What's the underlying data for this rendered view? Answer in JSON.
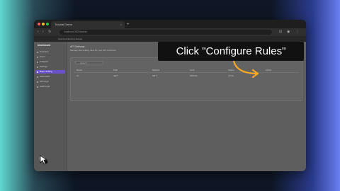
{
  "browser": {
    "tab_title": "Tutorial Demo",
    "tab_close": "×",
    "new_tab": "+",
    "url": "localhost:3000/admin",
    "nav": {
      "back": "‹",
      "forward": "›",
      "reload": "↻"
    },
    "bookmarks": [
      "Dashboard",
      "Getting Started"
    ]
  },
  "sidebar": {
    "brand": "Dashboard",
    "items": [
      {
        "label": "Overview"
      },
      {
        "label": "Users"
      },
      {
        "label": "Analytics"
      },
      {
        "label": "Settings"
      },
      {
        "label": "Rate Limiting"
      },
      {
        "label": "Webhooks"
      },
      {
        "label": "API Keys"
      },
      {
        "label": "Audit Logs"
      }
    ],
    "active_index": 4
  },
  "main": {
    "title": "API Gateway",
    "subtitle": "Manage rate limiting rules for your API endpoints",
    "search_placeholder": "Search",
    "table": {
      "headers": [
        "Name",
        "Path",
        "Method",
        "Limit",
        "Status",
        "Action"
      ],
      "row": [
        "v1",
        "/api/*",
        "GET",
        "100/min",
        "Active"
      ],
      "action_label": "Configure Rules"
    }
  },
  "overlay": {
    "caption": "Click \"Configure Rules\"",
    "accent_color": "#f7a823"
  }
}
